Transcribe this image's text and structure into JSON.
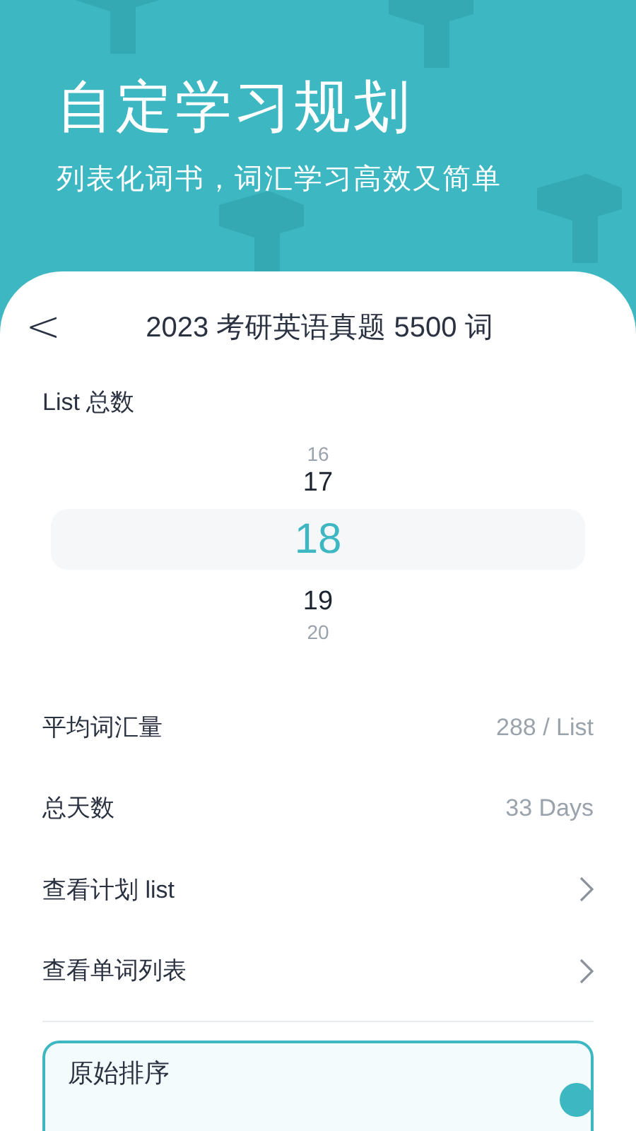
{
  "banner": {
    "title": "自定学习规划",
    "subtitle": "列表化词书，词汇学习高效又简单"
  },
  "header": {
    "back": "<",
    "title": "2023 考研英语真题 5500 词"
  },
  "picker": {
    "label": "List 总数",
    "options": [
      {
        "value": "16",
        "selected": false
      },
      {
        "value": "17",
        "selected": false
      },
      {
        "value": "18",
        "selected": true
      },
      {
        "value": "19",
        "selected": false
      },
      {
        "value": "20",
        "selected": false
      }
    ]
  },
  "rows": [
    {
      "kind": "value",
      "label": "平均词汇量",
      "value": "288 / List"
    },
    {
      "kind": "value",
      "label": "总天数",
      "value": "33 Days"
    },
    {
      "kind": "link",
      "label": "查看计划 list"
    },
    {
      "kind": "link",
      "label": "查看单词列表"
    }
  ],
  "sort_options": [
    {
      "label": "原始排序",
      "selected": true
    }
  ]
}
